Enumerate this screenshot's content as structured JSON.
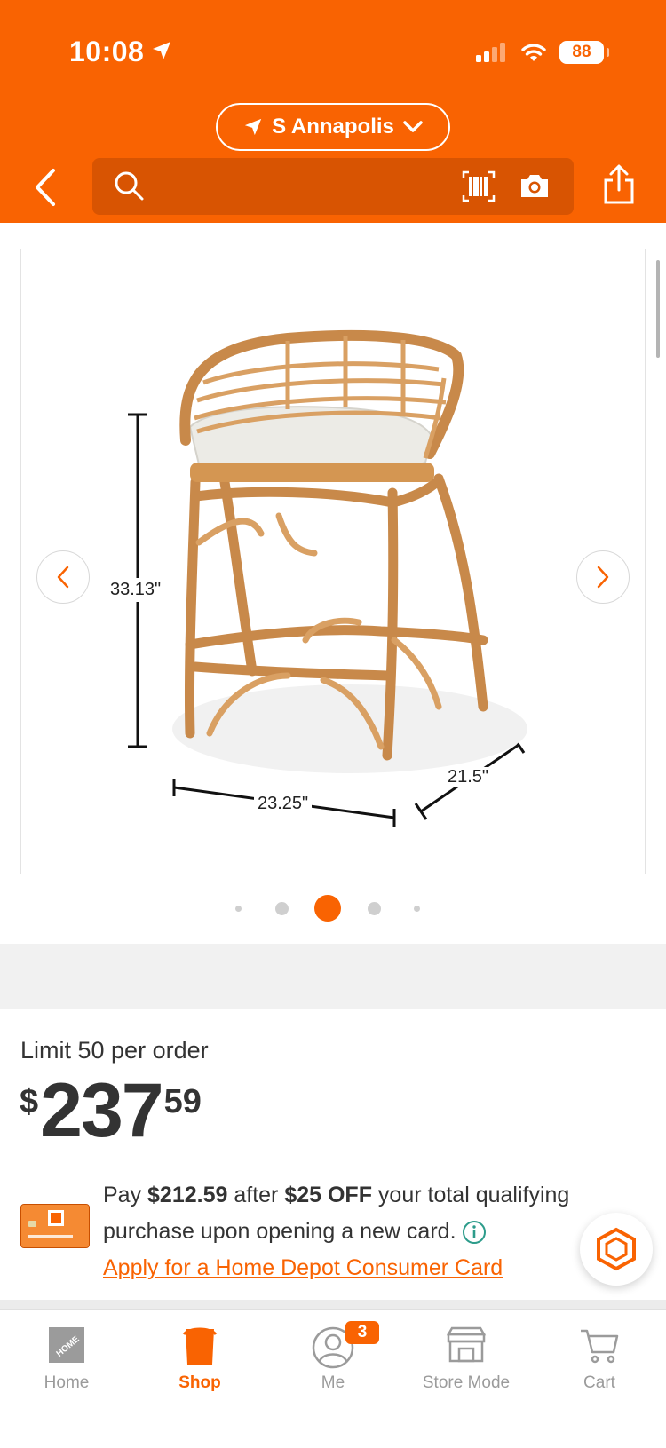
{
  "status_bar": {
    "time": "10:08",
    "battery": "88"
  },
  "header": {
    "store_name": "S Annapolis",
    "search_placeholder": ""
  },
  "product_image": {
    "dimensions": {
      "height": "33.13\"",
      "width": "23.25\"",
      "depth": "21.5\""
    },
    "carousel": {
      "count": 5,
      "active_index": 2
    }
  },
  "purchase": {
    "limit_text": "Limit 50 per order",
    "price": {
      "currency": "$",
      "dollars": "237",
      "cents": "59"
    },
    "promo": {
      "pay_prefix": "Pay ",
      "pay_amount": "$212.59",
      "after_text": " after ",
      "discount": "$25 OFF",
      "rest_text": " your total qualifying purchase upon opening a new card.",
      "apply_link": "Apply for a Home Depot Consumer Card"
    }
  },
  "tabbar": {
    "items": [
      {
        "label": "Home",
        "icon": "home-depot-logo-icon",
        "active": false
      },
      {
        "label": "Shop",
        "icon": "bucket-icon",
        "active": true
      },
      {
        "label": "Me",
        "icon": "person-icon",
        "active": false
      },
      {
        "label": "Store Mode",
        "icon": "store-icon",
        "active": false
      },
      {
        "label": "Cart",
        "icon": "cart-icon",
        "active": false
      }
    ],
    "me_badge": "3"
  },
  "colors": {
    "brand": "#f96302",
    "brand_dark": "#d85402",
    "text": "#333333",
    "muted": "#9b9b9b"
  }
}
